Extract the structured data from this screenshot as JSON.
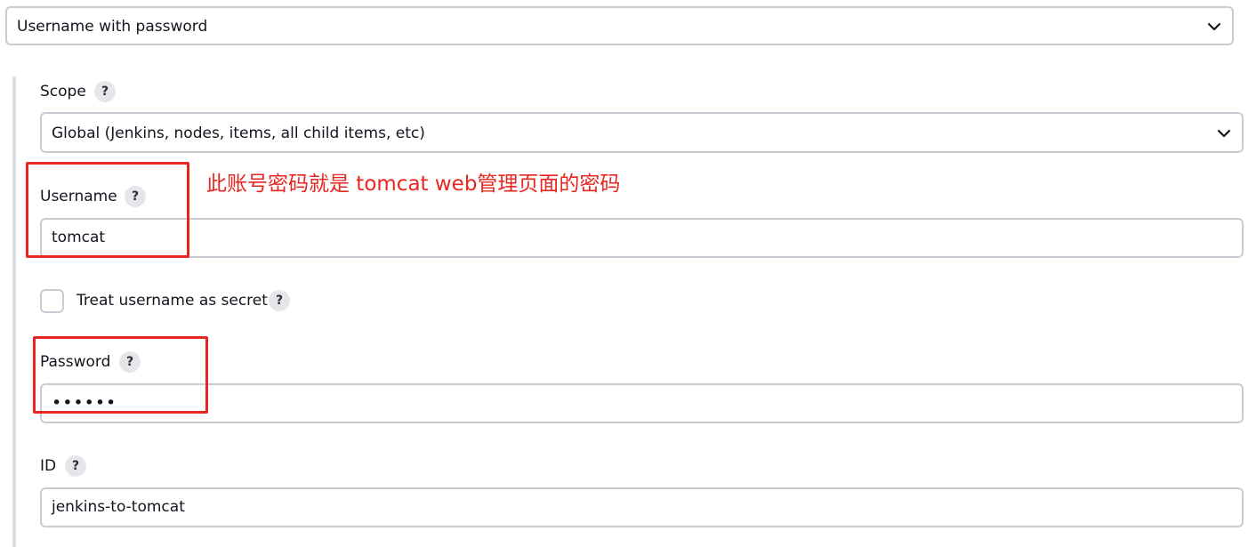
{
  "kind": {
    "selected": "Username with password"
  },
  "scope": {
    "label": "Scope",
    "help": "?",
    "selected": "Global (Jenkins, nodes, items, all child items, etc)"
  },
  "username": {
    "label": "Username",
    "help": "?",
    "value": "tomcat"
  },
  "treat_secret": {
    "label": "Treat username as secret",
    "help": "?",
    "checked": false
  },
  "password": {
    "label": "Password",
    "help": "?",
    "masked_value": "••••••"
  },
  "id_field": {
    "label": "ID",
    "help": "?",
    "value": "jenkins-to-tomcat"
  },
  "annotation": {
    "text": "此账号密码就是 tomcat web管理页面的密码",
    "color": "#e8261f"
  },
  "icons": {
    "kind_dropdown": "chevron-down-icon",
    "scope_dropdown": "chevron-down-icon",
    "help": "help-icon"
  }
}
